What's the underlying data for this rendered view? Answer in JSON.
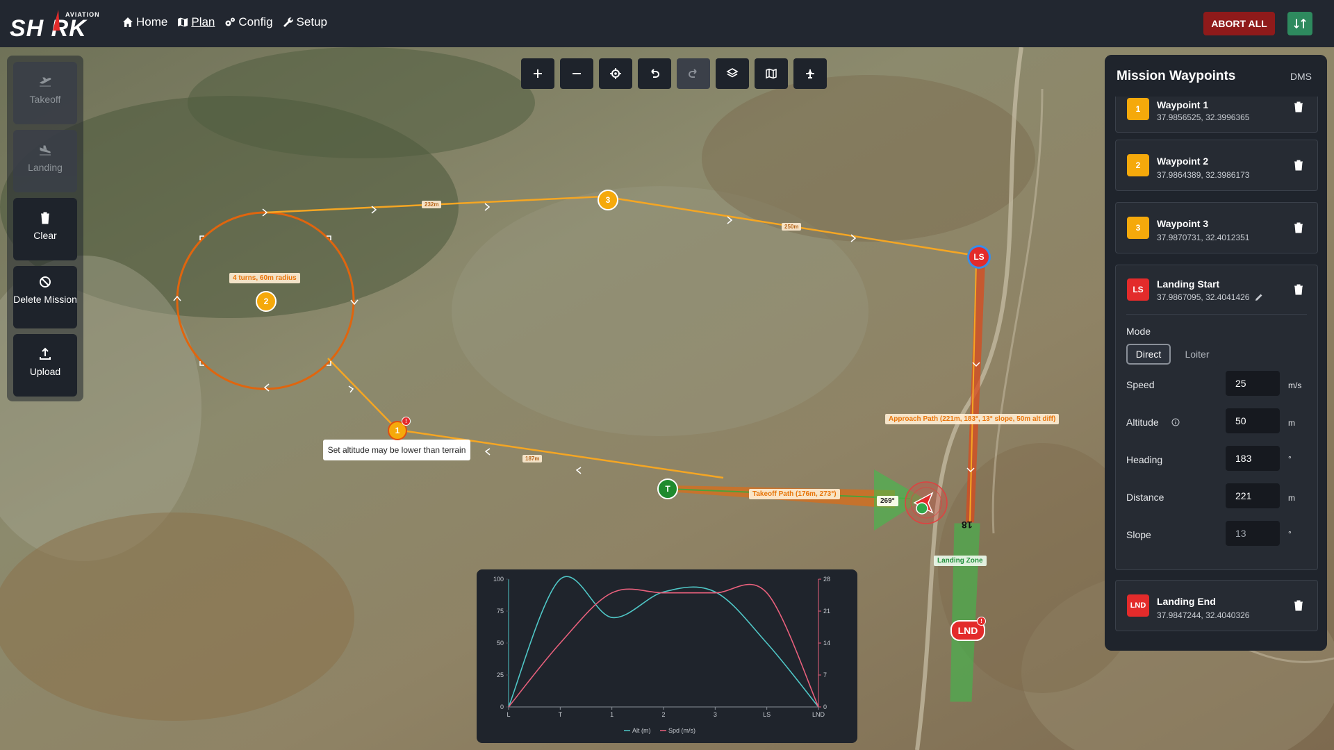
{
  "brand": {
    "aviation": "AVIATION",
    "name": "SH RK"
  },
  "nav": [
    {
      "label": "Home",
      "icon": "home-icon"
    },
    {
      "label": "Plan",
      "icon": "map-icon",
      "active": true
    },
    {
      "label": "Config",
      "icon": "gears-icon"
    },
    {
      "label": "Setup",
      "icon": "wrench-icon"
    }
  ],
  "header": {
    "abort_label": "ABORT ALL",
    "sync_icon": "sync-icon"
  },
  "tools": [
    {
      "label": "Takeoff",
      "icon": "plane-takeoff-icon",
      "disabled": true
    },
    {
      "label": "Landing",
      "icon": "plane-landing-icon",
      "disabled": true
    },
    {
      "label": "Clear",
      "icon": "trash-icon"
    },
    {
      "label": "Delete Mission",
      "icon": "ban-icon"
    },
    {
      "label": "Upload",
      "icon": "upload-icon"
    }
  ],
  "map_toolbar": [
    {
      "name": "zoom-in",
      "icon": "plus-icon"
    },
    {
      "name": "zoom-out",
      "icon": "minus-icon"
    },
    {
      "name": "locate",
      "icon": "crosshair-icon"
    },
    {
      "name": "undo",
      "icon": "undo-icon"
    },
    {
      "name": "redo",
      "icon": "redo-icon",
      "disabled": true
    },
    {
      "name": "layers",
      "icon": "layers-icon"
    },
    {
      "name": "map-view",
      "icon": "map-icon"
    },
    {
      "name": "vehicle",
      "icon": "drone-icon"
    }
  ],
  "map": {
    "tooltip": "Set altitude may be lower than terrain",
    "loiter_label": "4 turns, 60m radius",
    "approach_label": "Approach Path (221m, 183°, 13° slope, 50m alt diff)",
    "takeoff_label": "Takeoff Path (176m, 273°)",
    "heading_badge": "269°",
    "landing_zone_label": "Landing Zone",
    "runway_number": "18",
    "distances": [
      "232m",
      "250m",
      "187m"
    ],
    "markers": {
      "wp1": "1",
      "wp2": "2",
      "wp3": "3",
      "takeoff": "T",
      "landing_start": "LS",
      "landing_end": "LND"
    }
  },
  "panel": {
    "title": "Mission Waypoints",
    "format": "DMS",
    "waypoints": [
      {
        "badge": "1",
        "name": "Waypoint 1",
        "coords": "37.9856525, 32.3996365"
      },
      {
        "badge": "2",
        "name": "Waypoint 2",
        "coords": "37.9864389, 32.3986173"
      },
      {
        "badge": "3",
        "name": "Waypoint 3",
        "coords": "37.9870731, 32.4012351"
      }
    ],
    "landing_start": {
      "badge": "LS",
      "name": "Landing Start",
      "coords": "37.9867095, 32.4041426",
      "mode_label": "Mode",
      "modes": [
        "Direct",
        "Loiter"
      ],
      "selected_mode": "Direct",
      "fields": [
        {
          "label": "Speed",
          "value": "25",
          "unit": "m/s"
        },
        {
          "label": "Altitude",
          "value": "50",
          "unit": "m",
          "info": true
        },
        {
          "label": "Heading",
          "value": "183",
          "unit": "°"
        },
        {
          "label": "Distance",
          "value": "221",
          "unit": "m"
        },
        {
          "label": "Slope",
          "value": "13",
          "unit": "°",
          "readonly": true
        }
      ]
    },
    "landing_end": {
      "badge": "LND",
      "name": "Landing End",
      "coords": "37.9847244, 32.4040326"
    }
  },
  "chart_data": {
    "type": "line",
    "categories": [
      "L",
      "T",
      "1",
      "2",
      "3",
      "LS",
      "LND"
    ],
    "x": [
      0,
      1,
      2,
      3,
      4,
      5,
      6
    ],
    "series": [
      {
        "name": "Alt (m)",
        "axis": "left",
        "color": "#4fc6c6",
        "values": [
          0,
          100,
          70,
          90,
          90,
          50,
          0
        ]
      },
      {
        "name": "Spd (m/s)",
        "axis": "right",
        "color": "#e8607c",
        "values": [
          0,
          14,
          25,
          25,
          25,
          25,
          0
        ]
      }
    ],
    "y_left": {
      "ticks": [
        0,
        25,
        50,
        75,
        100
      ],
      "range": [
        0,
        100
      ]
    },
    "y_right": {
      "ticks": [
        0,
        7,
        14,
        21,
        28
      ],
      "range": [
        0,
        28
      ]
    },
    "legend": "bottom"
  }
}
